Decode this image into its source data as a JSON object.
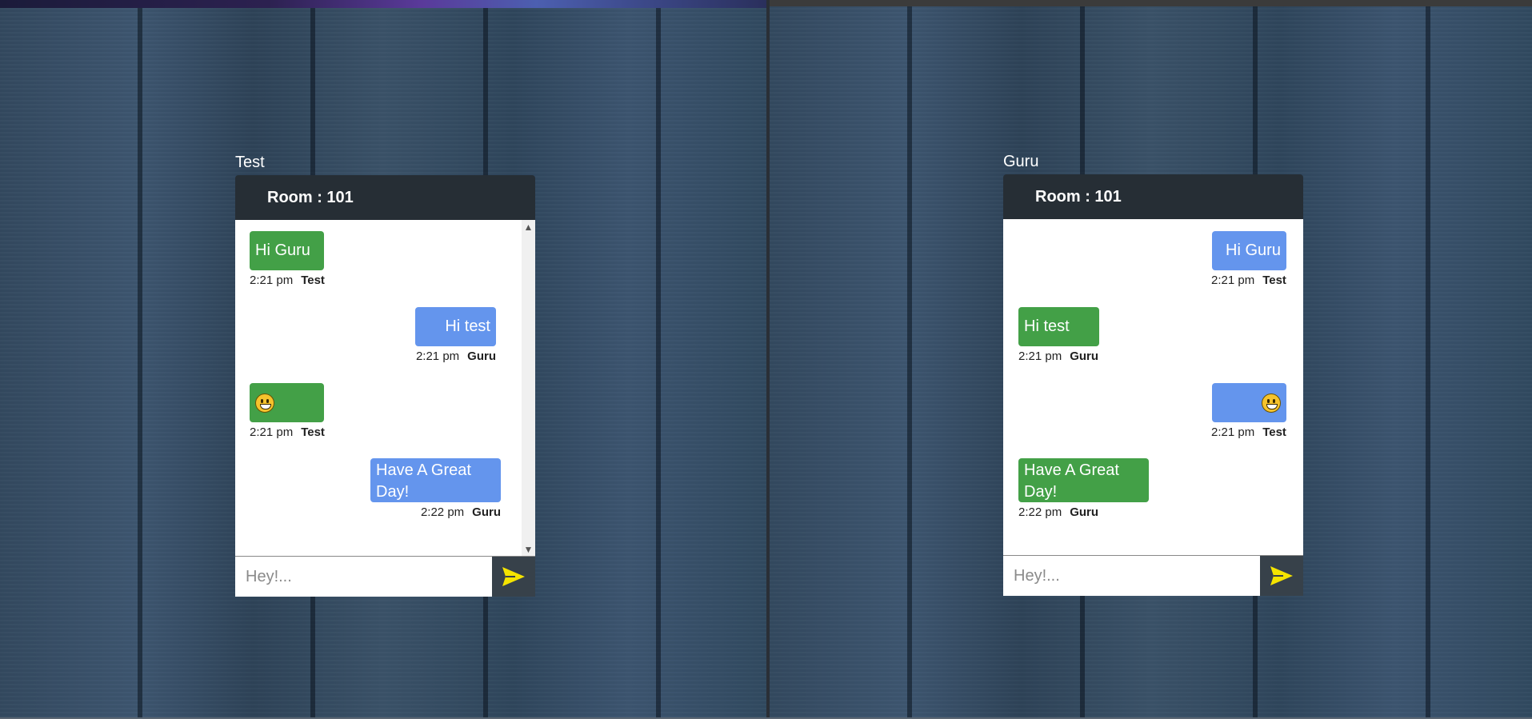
{
  "colors": {
    "header_bg": "#262e35",
    "sent_bubble": "#43a047",
    "received_bubble": "#6495ed",
    "send_button_bg": "#37414a",
    "send_icon": "#f5e400"
  },
  "panes": [
    {
      "username": "Test",
      "room_title": "Room : 101",
      "input_placeholder": "Hey!...",
      "send_icon": "paper-plane-icon",
      "messages": [
        {
          "text": "Hi Guru",
          "time": "2:21 pm",
          "author": "Test",
          "side": "left",
          "color": "green"
        },
        {
          "text": "Hi test",
          "time": "2:21 pm",
          "author": "Guru",
          "side": "right",
          "color": "blue"
        },
        {
          "text": "",
          "emoji": "grinning-face-emoji",
          "time": "2:21 pm",
          "author": "Test",
          "side": "left",
          "color": "green"
        },
        {
          "text": "Have A Great Day!",
          "time": "2:22 pm",
          "author": "Guru",
          "side": "right",
          "color": "blue"
        }
      ]
    },
    {
      "username": "Guru",
      "room_title": "Room : 101",
      "input_placeholder": "Hey!...",
      "send_icon": "paper-plane-icon",
      "messages": [
        {
          "text": "Hi Guru",
          "time": "2:21 pm",
          "author": "Test",
          "side": "right",
          "color": "blue"
        },
        {
          "text": "Hi test",
          "time": "2:21 pm",
          "author": "Guru",
          "side": "left",
          "color": "green"
        },
        {
          "text": "",
          "emoji": "grinning-face-emoji",
          "time": "2:21 pm",
          "author": "Test",
          "side": "right",
          "color": "blue"
        },
        {
          "text": "Have A Great Day!",
          "time": "2:22 pm",
          "author": "Guru",
          "side": "left",
          "color": "green"
        }
      ]
    }
  ]
}
